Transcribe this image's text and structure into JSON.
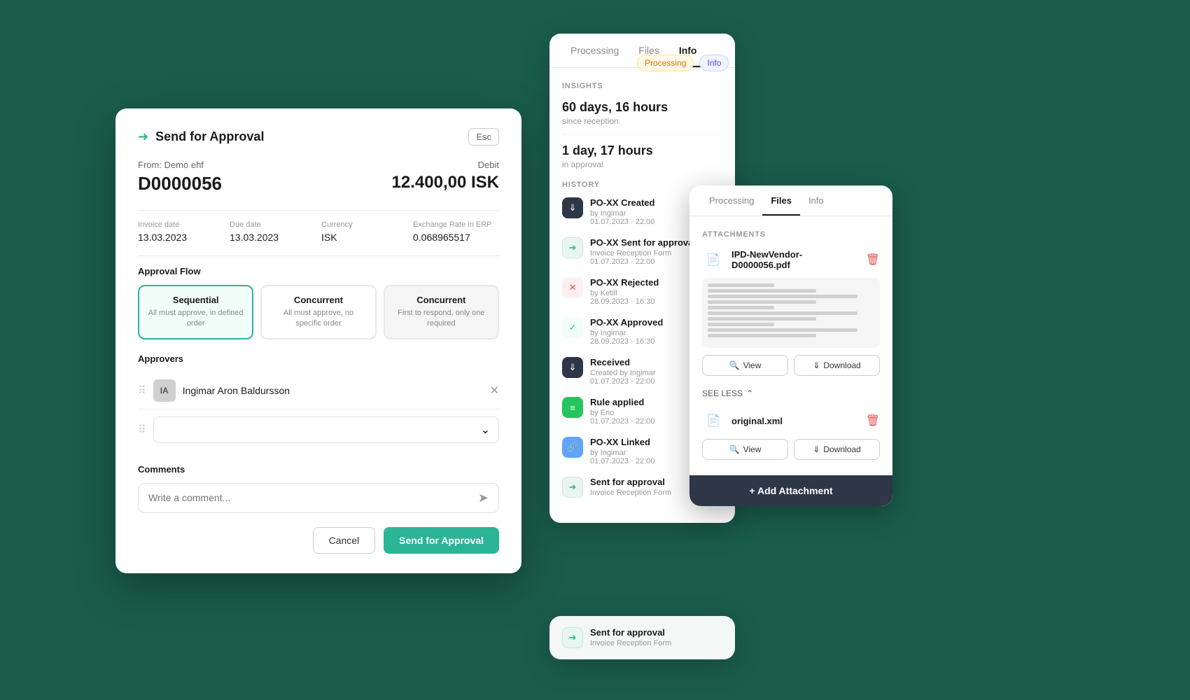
{
  "modal": {
    "title": "Send for Approval",
    "esc_label": "Esc",
    "from_label": "From: Demo ehf",
    "invoice_id": "D0000056",
    "debit_label": "Debit",
    "debit_amount": "12.400,00 ISK",
    "details": {
      "invoice_date_label": "Invoice date",
      "invoice_date_value": "13.03.2023",
      "due_date_label": "Due date",
      "due_date_value": "13.03.2023",
      "currency_label": "Currency",
      "currency_value": "ISK",
      "exchange_label": "Exchange Rate in ERP",
      "exchange_value": "0.068965517"
    },
    "approval_flow_label": "Approval Flow",
    "flow_options": [
      {
        "title": "Sequential",
        "desc": "All must approve,\nin defined order",
        "active": true
      },
      {
        "title": "Concurrent",
        "desc": "All must approve,\nno specific order",
        "active": false
      },
      {
        "title": "Concurrent",
        "desc": "First to respond,\nonly one required",
        "active": false
      }
    ],
    "approvers_label": "Approvers",
    "approver_initials": "IA",
    "approver_name": "Ingimar Aron Baldursson",
    "comments_label": "Comments",
    "comment_placeholder": "Write a comment...",
    "cancel_label": "Cancel",
    "send_label": "Send for Approval"
  },
  "panel1": {
    "tabs": [
      "Processing",
      "Files",
      "Info"
    ],
    "active_tab": "Info",
    "insights_label": "INSIGHTS",
    "insight1_value": "60 days, 16 hours",
    "insight1_sub": "since reception",
    "insight2_value": "1 day, 17 hours",
    "insight2_sub": "in approval",
    "history_label": "HISTORY",
    "history_items": [
      {
        "title": "PO-XX Created",
        "sub": "by Ingimar\n01.07.2023 · 22:00",
        "type": "download"
      },
      {
        "title": "PO-XX Sent for approval",
        "sub2": "Invoice Reception Form",
        "sub3": "01.07.2023 · 22:00",
        "type": "send"
      },
      {
        "title": "PO-XX Rejected",
        "sub": "by Ketill\n28.09.2023 · 16:30",
        "type": "reject"
      },
      {
        "title": "PO-XX Approved",
        "sub": "by Ingimar\n28.09.2023 · 16:30",
        "type": "approve"
      },
      {
        "title": "Received",
        "sub": "Created by Ingimar\n01.07.2023 · 22:00",
        "type": "received"
      },
      {
        "title": "Rule applied",
        "sub": "by Eno\n01.07.2023 · 22:00",
        "type": "rule"
      },
      {
        "title": "PO-XX Linked",
        "sub": "by Ingimar\n01.07.2023 · 22:00",
        "type": "link"
      },
      {
        "title": "Sent for approval",
        "sub2": "Invoice Reception Form",
        "type": "send2"
      }
    ]
  },
  "panel2": {
    "tabs": [
      "Processing",
      "Files",
      "Info"
    ],
    "active_tab": "Files",
    "attachments_label": "ATTACHMENTS",
    "pdf_name": "IPD-NewVendor-D0000056.pdf",
    "view_label": "View",
    "download_label": "Download",
    "see_less_label": "SEE LESS",
    "xml_name": "original.xml",
    "view_label2": "View",
    "download_label2": "Download",
    "add_attachment_label": "+ Add Attachment"
  },
  "panel_badge1": {
    "processing_label": "Processing",
    "info_label": "Info"
  },
  "bottom_history": {
    "title": "Sent for approval",
    "sub": "Invoice Reception Form"
  }
}
